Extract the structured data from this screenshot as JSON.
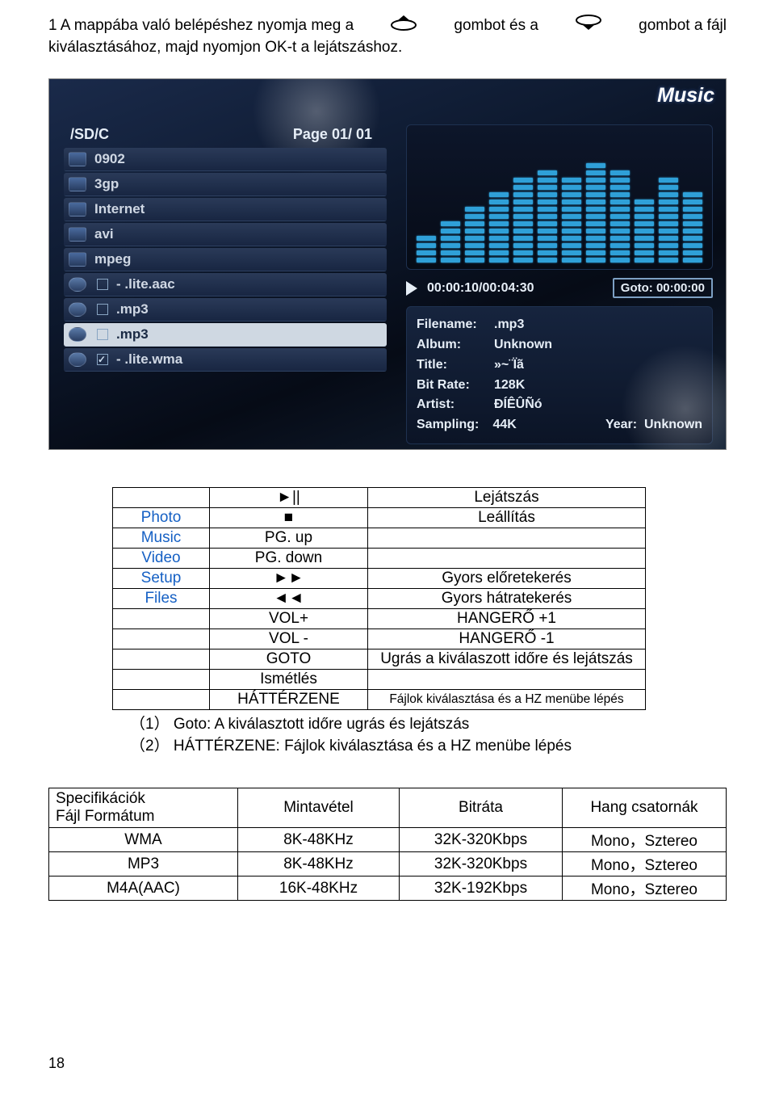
{
  "intro": {
    "seg1": "1 A mappába való belépéshez nyomja meg a",
    "seg2": "gombot és a",
    "seg3": "gombot a fájl",
    "line2": "kiválasztásához, majd nyomjon OK-t a lejátszáshoz."
  },
  "screenshot": {
    "title": "Music",
    "path": "/SD/C",
    "page": "Page 01/ 01",
    "files": [
      {
        "icon": "folder",
        "name": "0902"
      },
      {
        "icon": "folder",
        "name": "3gp"
      },
      {
        "icon": "folder",
        "name": "Internet"
      },
      {
        "icon": "folder",
        "name": "avi"
      },
      {
        "icon": "folder",
        "name": "mpeg"
      },
      {
        "icon": "music",
        "name": "- .lite.aac"
      },
      {
        "icon": "music",
        "name": ".mp3"
      },
      {
        "icon": "music",
        "name": ".mp3",
        "selected": true
      },
      {
        "icon": "music",
        "name": "- .lite.wma",
        "checked": true
      }
    ],
    "eq_bars": [
      4,
      6,
      8,
      10,
      12,
      13,
      12,
      14,
      13,
      9,
      12,
      10
    ],
    "time": "00:00:10/00:04:30",
    "goto": "Goto: 00:00:00",
    "meta": {
      "Filename": ".mp3",
      "Album": "Unknown",
      "Title": "»~¨Ïã",
      "BitRate": "128K",
      "Artist": "ÐÍÊÛÑó",
      "Sampling": "44K",
      "Year": "Unknown"
    }
  },
  "controls": [
    {
      "c1": "",
      "c2": "►||",
      "c3": "Lejátszás"
    },
    {
      "c1": "Photo",
      "c2": "■",
      "c3": "Leállítás"
    },
    {
      "c1": "Music",
      "c2": "PG. up",
      "c3": ""
    },
    {
      "c1": "Video",
      "c2": "PG. down",
      "c3": ""
    },
    {
      "c1": "Setup",
      "c2": "►►",
      "c3": "Gyors előretekerés"
    },
    {
      "c1": "Files",
      "c2": "◄◄",
      "c3": "Gyors hátratekerés"
    },
    {
      "c1": "",
      "c2": "VOL+",
      "c3": "HANGERŐ +1"
    },
    {
      "c1": "",
      "c2": "VOL -",
      "c3": "HANGERŐ -1"
    },
    {
      "c1": "",
      "c2": "GOTO",
      "c3": "Ugrás a kiválaszott időre és lejátszás"
    },
    {
      "c1": "",
      "c2": "Ismétlés",
      "c3": ""
    },
    {
      "c1": "",
      "c2": "HÁTTÉRZENE",
      "c3": "Fájlok kiválasztása és a HZ menübe lépés",
      "small": true
    }
  ],
  "notes": [
    "（1） Goto: A kiválasztott időre ugrás és lejátszás",
    "（2） HÁTTÉRZENE: Fájlok kiválasztása és a HZ menübe lépés"
  ],
  "spec": {
    "headers": [
      "Specifikációk\nFájl Formátum",
      "Mintavétel",
      "Bitráta",
      "Hang csatornák"
    ],
    "rows": [
      [
        "WMA",
        "8K-48KHz",
        "32K-320Kbps",
        "Mono，Sztereo"
      ],
      [
        "MP3",
        "8K-48KHz",
        "32K-320Kbps",
        "Mono，Sztereo"
      ],
      [
        "M4A(AAC)",
        "16K-48KHz",
        "32K-192Kbps",
        "Mono，Sztereo"
      ]
    ]
  },
  "page_number": "18"
}
